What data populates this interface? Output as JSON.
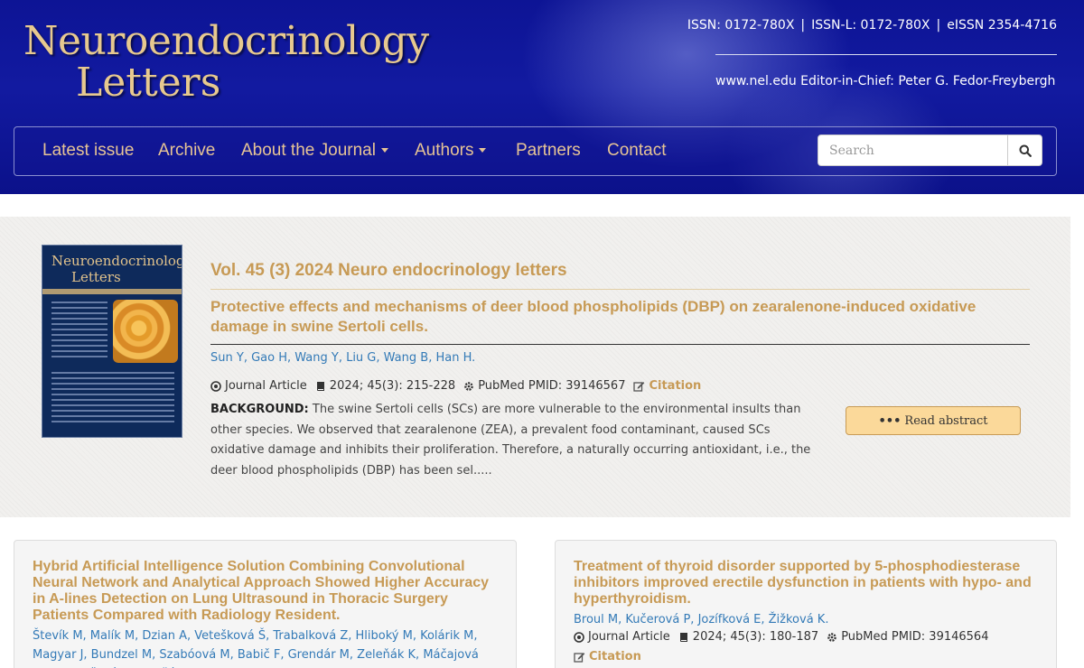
{
  "header": {
    "logo_line1": "Neuroendocrinology",
    "logo_line2": "Letters",
    "issn": "ISSN: 0172-780X",
    "issn_l": "ISSN-L: 0172-780X",
    "eissn": "eISSN 2354-4716",
    "separator": "|",
    "website": "www.nel.edu Editor-in-Chief: Peter G. Fedor-Freybergh"
  },
  "nav": {
    "items": [
      {
        "label": "Latest issue"
      },
      {
        "label": "Archive"
      },
      {
        "label": "About the Journal"
      },
      {
        "label": "Authors"
      },
      {
        "label": "Partners"
      },
      {
        "label": "Contact"
      }
    ],
    "search_placeholder": "Search"
  },
  "feature": {
    "cover_title_line1": "Neuroendocrinology",
    "cover_title_line2": "Letters",
    "volume": "Vol. 45 (3) 2024 Neuro endocrinology letters",
    "title": "Protective effects and mechanisms of deer blood phospholipids (DBP) on zearalenone-induced oxidative damage in swine Sertoli cells.",
    "authors": [
      "Sun Y",
      "Gao H",
      "Wang Y",
      "Liu G",
      "Wang B",
      "Han H."
    ],
    "type": "Journal Article",
    "issue": "2024; 45(3): 215-228",
    "pubmed": "PubMed PMID: 39146567",
    "citation": "Citation",
    "abstract_label": "BACKGROUND:",
    "abstract_text": " The swine Sertoli cells (SCs) are more vulnerable to the environmental insults than other species. We observed that zearalenone (ZEA), a prevalent food contaminant, caused SCs oxidative damage and inhibits their proliferation. Therefore, a naturally occurring antioxidant, i.e., the deer blood phospholipids (DBP) has been sel.....",
    "read_abstract": "Read abstract"
  },
  "cards": [
    {
      "title": "Hybrid Artificial Intelligence Solution Combining Convolutional Neural Network and Analytical Approach Showed Higher Accuracy in A-lines Detection on Lung Ultrasound in Thoracic Surgery Patients Compared with Radiology Resident.",
      "authors": "Števík M, Malík M, Dzian A, Vetešková Š, Trabalková Z, Hliboký M, Kolárik M, Magyar J, Bundzel M, Szabóová M, Babič F, Grendár M, Zeleňák K, Máčajová V, Paulovičová Ľ, Zeleňák K."
    },
    {
      "title": "Treatment of thyroid disorder supported by 5-phosphodiesterase inhibitors improved erectile dysfunction in patients with hypo- and hyperthyroidism.",
      "authors": "Broul M, Kučerová P, Jozífková E, Žižková K.",
      "type": "Journal Article",
      "issue": "2024; 45(3): 180-187",
      "pubmed": "PubMed PMID: 39146564",
      "citation": "Citation"
    }
  ],
  "colors": {
    "header_blue": "#0d1495",
    "gold": "#c79a55",
    "link_blue": "#337ab7",
    "button_fill": "#fbd99a"
  }
}
